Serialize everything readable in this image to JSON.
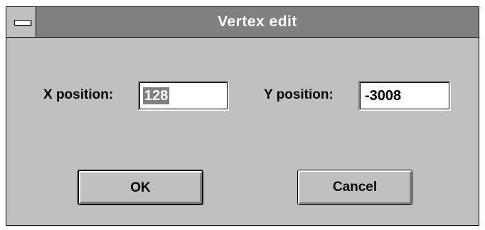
{
  "dialog": {
    "title": "Vertex edit",
    "system_menu_icon": "system-menu-dash-icon"
  },
  "fields": {
    "x_label": "X position:",
    "x_value": "128",
    "y_label": "Y position:",
    "y_value": "-3008"
  },
  "buttons": {
    "ok_label": "OK",
    "cancel_label": "Cancel"
  },
  "colors": {
    "title_bar": "#808080",
    "dialog_face": "#c0c0c0",
    "selection": "#808080"
  }
}
